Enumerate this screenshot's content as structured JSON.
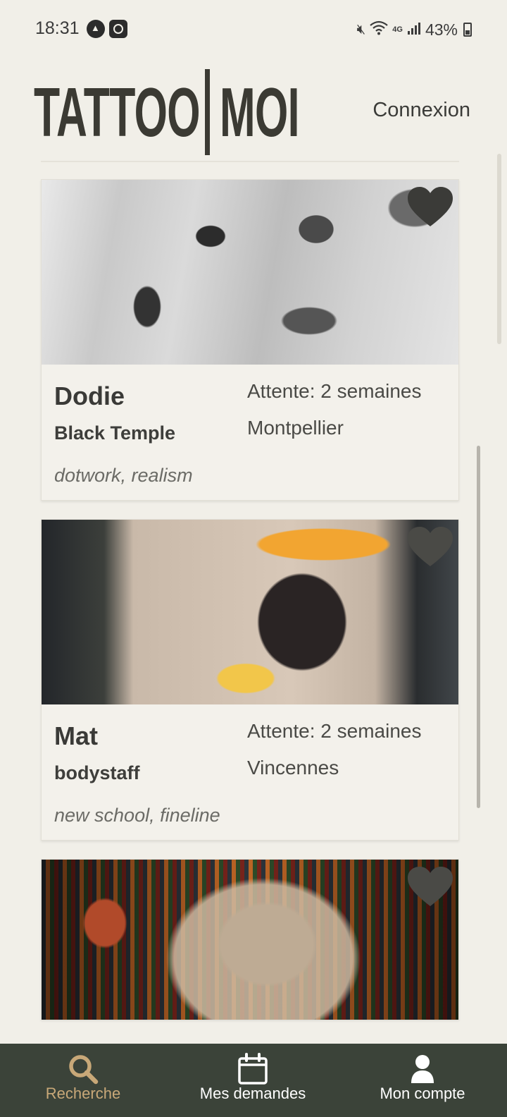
{
  "status_bar": {
    "time": "18:31",
    "battery": "43%",
    "network": "4G",
    "icons": [
      "notification-app-a-icon",
      "notification-app-b-icon",
      "mute-icon",
      "wifi-icon",
      "signal-icon",
      "battery-icon"
    ]
  },
  "header": {
    "logo_left": "TATTOO",
    "logo_right": "MOI",
    "login_label": "Connexion"
  },
  "cards": [
    {
      "artist": "Dodie",
      "studio": "Black Temple",
      "styles": "dotwork, realism",
      "wait": "Attente: 2 semaines",
      "city": "Montpellier",
      "favorite_icon": "heart-icon"
    },
    {
      "artist": "Mat",
      "studio": "bodystaff",
      "styles": "new school, fineline",
      "wait": "Attente: 2 semaines",
      "city": "Vincennes",
      "favorite_icon": "heart-icon"
    },
    {
      "favorite_icon": "heart-icon"
    }
  ],
  "bottom_nav": {
    "items": [
      {
        "label": "Recherche",
        "icon": "search-icon",
        "active": true
      },
      {
        "label": "Mes demandes",
        "icon": "calendar-icon",
        "active": false
      },
      {
        "label": "Mon compte",
        "icon": "user-icon",
        "active": false
      }
    ]
  },
  "colors": {
    "background": "#f1efe8",
    "nav_background": "#3b4339",
    "nav_active": "#c8a878",
    "text_dark": "#3a3a37"
  }
}
